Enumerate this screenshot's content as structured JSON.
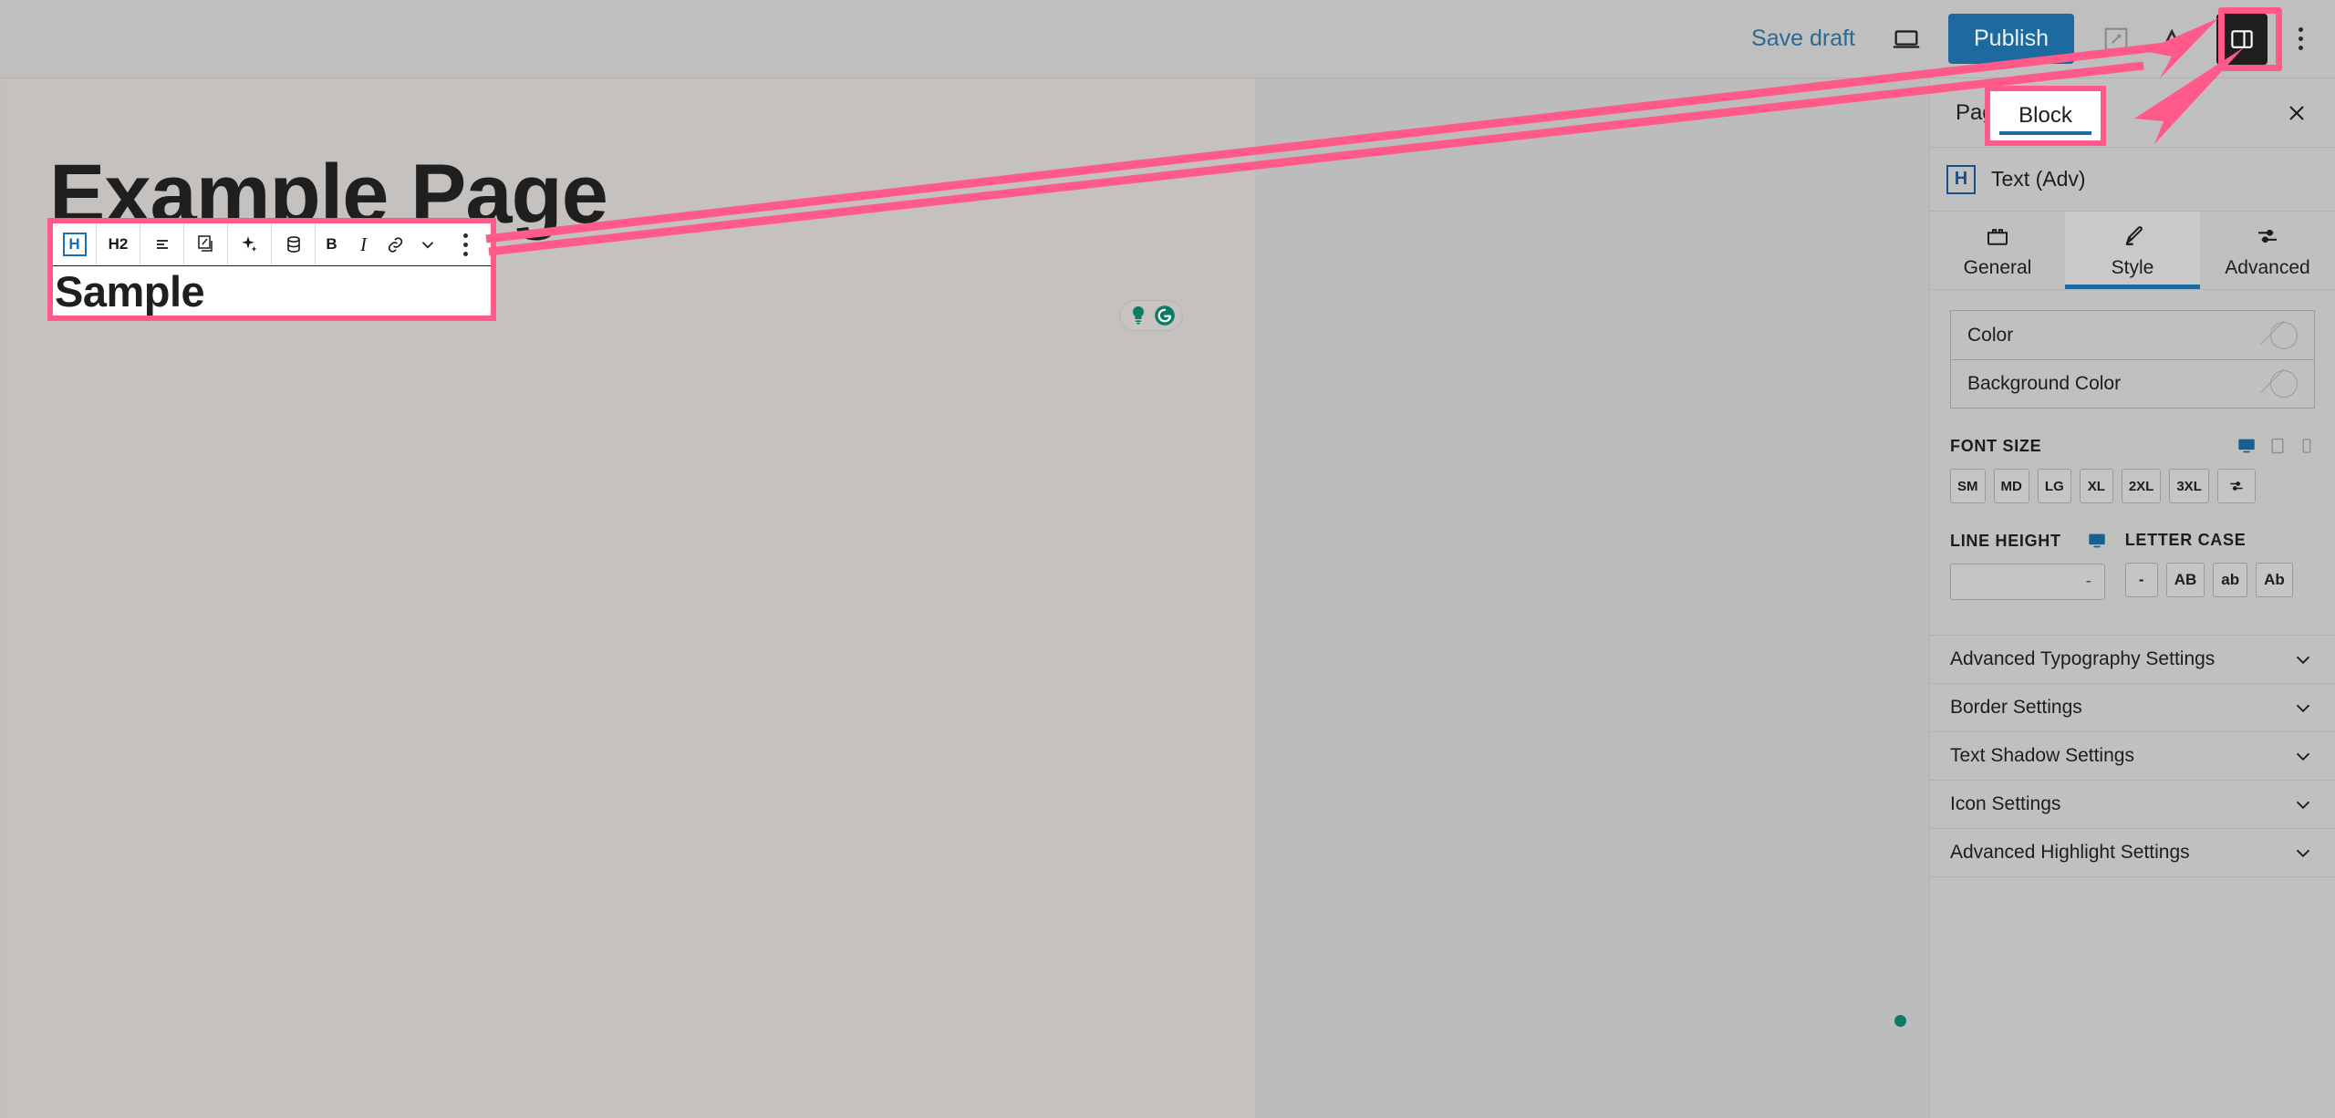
{
  "topbar": {
    "save_draft_label": "Save draft",
    "publish_label": "Publish",
    "preview_icon": "laptop-preview-icon",
    "view_icon": "view-page-icon",
    "sidebar_toggle_icon": "settings-sidebar-toggle-icon",
    "more_menu_icon": "vertical-dots-icon",
    "publish_color": "#1c6a9e",
    "save_draft_color": "#2a6a92"
  },
  "canvas": {
    "post_title": "Example Page",
    "selected_block_text": "Sample",
    "annotation_color": "#ff5a8a",
    "toolbar": {
      "buttons": [
        {
          "name": "block-type-heading",
          "label": "H",
          "icon": "heading-block-icon",
          "active": true
        },
        {
          "name": "heading-level",
          "label": "H2",
          "icon": "heading-level-icon",
          "active": false
        },
        {
          "name": "text-align",
          "label": "",
          "icon": "align-left-icon",
          "active": false
        },
        {
          "name": "transform-block",
          "label": "",
          "icon": "transform-block-icon",
          "active": false
        },
        {
          "name": "ai-assist",
          "label": "",
          "icon": "sparkle-ai-icon",
          "active": false
        },
        {
          "name": "dynamic-data",
          "label": "",
          "icon": "database-icon",
          "active": false
        },
        {
          "name": "bold",
          "label": "B",
          "icon": "bold-icon",
          "active": false
        },
        {
          "name": "italic",
          "label": "I",
          "icon": "italic-icon",
          "active": false
        },
        {
          "name": "insert-link",
          "label": "",
          "icon": "link-icon",
          "active": false
        },
        {
          "name": "more-formatting",
          "label": "",
          "icon": "chevron-down-icon",
          "active": false
        },
        {
          "name": "block-options",
          "label": "",
          "icon": "vertical-dots-icon",
          "active": false
        }
      ]
    },
    "grammarly": {
      "hint_icon": "lightbulb-icon",
      "logo_icon": "grammarly-logo-icon",
      "color": "#0d7a63"
    }
  },
  "sidebar": {
    "tabs": [
      {
        "label": "Page",
        "active": false
      },
      {
        "label": "Block",
        "active": true
      }
    ],
    "close_icon": "close-icon",
    "block_info": {
      "icon": "heading-block-icon",
      "icon_letter": "H",
      "name": "Text (Adv)"
    },
    "sub_tabs": [
      {
        "label": "General",
        "icon": "blocks-icon",
        "active": false
      },
      {
        "label": "Style",
        "icon": "brush-icon",
        "active": true
      },
      {
        "label": "Advanced",
        "icon": "sliders-icon",
        "active": false
      }
    ],
    "colors": [
      {
        "label": "Color",
        "value": "none",
        "swatch": "no-color-icon"
      },
      {
        "label": "Background Color",
        "value": "none",
        "swatch": "no-color-icon"
      }
    ],
    "font_size": {
      "title": "FONT SIZE",
      "devices": [
        {
          "icon": "desktop-icon",
          "active": true
        },
        {
          "icon": "tablet-icon",
          "active": false
        },
        {
          "icon": "mobile-icon",
          "active": false
        }
      ],
      "options": [
        "SM",
        "MD",
        "LG",
        "XL",
        "2XL",
        "3XL"
      ],
      "custom_icon": "sliders-icon",
      "selected": null
    },
    "line_height": {
      "title": "LINE HEIGHT",
      "device_icon": "desktop-icon",
      "value": "-",
      "placeholder": "-"
    },
    "letter_case": {
      "title": "LETTER CASE",
      "options": [
        "-",
        "AB",
        "ab",
        "Ab"
      ],
      "selected": null
    },
    "accordions": [
      {
        "label": "Advanced Typography Settings",
        "expanded": false,
        "icon": "chevron-down-icon"
      },
      {
        "label": "Border Settings",
        "expanded": false,
        "icon": "chevron-down-icon"
      },
      {
        "label": "Text Shadow Settings",
        "expanded": false,
        "icon": "chevron-down-icon"
      },
      {
        "label": "Icon Settings",
        "expanded": false,
        "icon": "chevron-down-icon"
      },
      {
        "label": "Advanced Highlight Settings",
        "expanded": false,
        "icon": "chevron-down-icon"
      }
    ],
    "accent_color": "#1c6a9e"
  }
}
